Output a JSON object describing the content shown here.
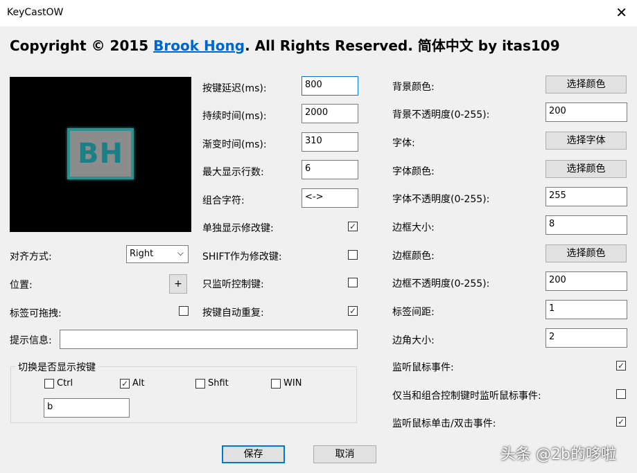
{
  "window": {
    "title": "KeyCastOW",
    "close": "✕"
  },
  "copyright": {
    "prefix": "Copyright © 2015 ",
    "author": "Brook Hong",
    "suffix": ". All Rights Reserved. 简体中文 by itas109"
  },
  "preview": {
    "logo_text": "BH"
  },
  "left": {
    "align_label": "对齐方式:",
    "align_value": "Right",
    "position_label": "位置:",
    "position_button": "+",
    "draggable_label": "标签可拖拽:",
    "draggable_checked": false,
    "tip_label": "提示信息:",
    "tip_value": ""
  },
  "middle": [
    {
      "label": "按键延迟(ms):",
      "value": "800"
    },
    {
      "label": "持续时间(ms):",
      "value": "2000"
    },
    {
      "label": "渐变时间(ms):",
      "value": "310"
    },
    {
      "label": "最大显示行数:",
      "value": "6"
    },
    {
      "label": "组合字符:",
      "value": "<->"
    }
  ],
  "middle_checks": [
    {
      "label": "单独显示修改键:",
      "checked": true
    },
    {
      "label": "SHIFT作为修改键:",
      "checked": false
    },
    {
      "label": "只监听控制键:",
      "checked": false
    },
    {
      "label": "按键自动重复:",
      "checked": true
    }
  ],
  "right": [
    {
      "label": "背景颜色:",
      "button": "选择颜色"
    },
    {
      "label": "背景不透明度(0-255):",
      "value": "200"
    },
    {
      "label": "字体:",
      "button": "选择字体"
    },
    {
      "label": "字体颜色:",
      "button": "选择颜色"
    },
    {
      "label": "字体不透明度(0-255):",
      "value": "255"
    },
    {
      "label": "边框大小:",
      "value": "8"
    },
    {
      "label": "边框颜色:",
      "button": "选择颜色"
    },
    {
      "label": "边框不透明度(0-255):",
      "value": "200"
    },
    {
      "label": "标签间距:",
      "value": "1"
    },
    {
      "label": "边角大小:",
      "value": "2"
    }
  ],
  "right_checks": [
    {
      "label": "监听鼠标事件:",
      "checked": true
    },
    {
      "label": "仅当和组合控制键时监听鼠标事件:",
      "checked": false
    },
    {
      "label": "监听鼠标单击/双击事件:",
      "checked": true
    }
  ],
  "toggle_group": {
    "title": "切换是否显示按键",
    "options": [
      {
        "label": "Ctrl",
        "checked": false
      },
      {
        "label": "Alt",
        "checked": true
      },
      {
        "label": "Shfit",
        "checked": false
      },
      {
        "label": "WIN",
        "checked": false
      }
    ],
    "key_value": "b"
  },
  "footer": {
    "save": "保存",
    "cancel": "取消"
  },
  "watermark": "头条 @2b的哆啦",
  "glyphs": {
    "check": "✓",
    "arrow": "⌵"
  }
}
